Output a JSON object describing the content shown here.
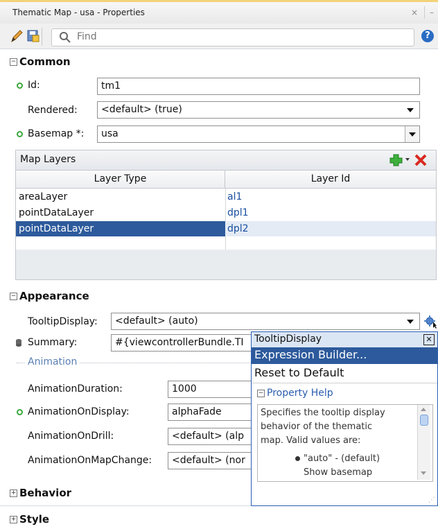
{
  "window": {
    "title": "Thematic Map - usa - Properties",
    "close_glyph": "×",
    "min_glyph": "–"
  },
  "toolbar": {
    "search_placeholder": "Find",
    "help_glyph": "?"
  },
  "common": {
    "section_label": "Common",
    "id": {
      "label": "Id:",
      "value": "tm1"
    },
    "rendered": {
      "label": "Rendered:",
      "value": "<default> (true)"
    },
    "basemap": {
      "label": "Basemap *:",
      "value": "usa"
    }
  },
  "map_layers": {
    "title": "Map Layers",
    "columns": [
      "Layer Type",
      "Layer Id"
    ],
    "rows": [
      {
        "type": "areaLayer",
        "id": "al1"
      },
      {
        "type": "pointDataLayer",
        "id": "dpl1"
      },
      {
        "type": "pointDataLayer",
        "id": "dpl2",
        "selected": true
      }
    ]
  },
  "appearance": {
    "section_label": "Appearance",
    "tooltip_display": {
      "label": "TooltipDisplay:",
      "value": "<default> (auto)"
    },
    "summary": {
      "label": "Summary:",
      "value": "#{viewcontrollerBundle.TI"
    },
    "animation_group": "Animation",
    "animation_duration": {
      "label": "AnimationDuration:",
      "value": "1000"
    },
    "animation_on_display": {
      "label": "AnimationOnDisplay:",
      "value": "alphaFade"
    },
    "animation_on_drill": {
      "label": "AnimationOnDrill:",
      "value": "<default> (alp"
    },
    "animation_on_map_change": {
      "label": "AnimationOnMapChange:",
      "value": "<default> (nor"
    }
  },
  "popup": {
    "title": "TooltipDisplay",
    "menu": [
      "Expression Builder...",
      "Reset to Default"
    ],
    "help_header": "Property Help",
    "help_lines": [
      "Specifies the tooltip display",
      "behavior of the thematic",
      "map. Valid values are:"
    ],
    "bullet_text": "\"auto\" - (default)",
    "cut_text": "Show basemap"
  },
  "behavior": {
    "section_label": "Behavior"
  },
  "style": {
    "section_label": "Style"
  },
  "colors": {
    "selection": "#2d5a9c",
    "link": "#1a4fa0",
    "required_dot": "#3aa83a"
  }
}
